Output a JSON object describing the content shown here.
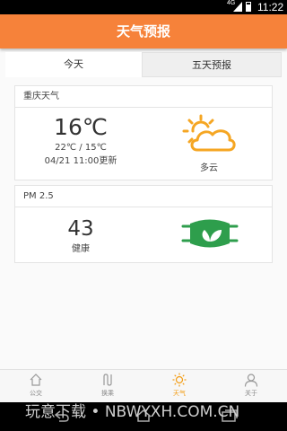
{
  "status_bar": {
    "network": "4G",
    "time": "11:22"
  },
  "header": {
    "title": "天气预报"
  },
  "tabs": [
    {
      "label": "今天",
      "active": true
    },
    {
      "label": "五天预报",
      "active": false
    }
  ],
  "weather": {
    "title": "重庆天气",
    "temperature": "16℃",
    "range": "22℃ / 15℃",
    "update": "04/21 11:00更新",
    "condition": "多云",
    "icon": "partly-cloudy-icon"
  },
  "pm25": {
    "title": "PM 2.5",
    "value": "43",
    "level": "健康",
    "icon": "mask-icon"
  },
  "bottom_nav": [
    {
      "label": "公交",
      "icon": "bus-icon",
      "active": false
    },
    {
      "label": "换乘",
      "icon": "transfer-icon",
      "active": false
    },
    {
      "label": "天气",
      "icon": "sun-icon",
      "active": true
    },
    {
      "label": "关于",
      "icon": "person-icon",
      "active": false
    }
  ],
  "watermark": "玩意下载 • NBWYXH.COM.CN",
  "colors": {
    "header": "#f6823a",
    "active_nav": "#f39c12",
    "mask": "#2e9e4c",
    "sun": "#f5a623"
  }
}
